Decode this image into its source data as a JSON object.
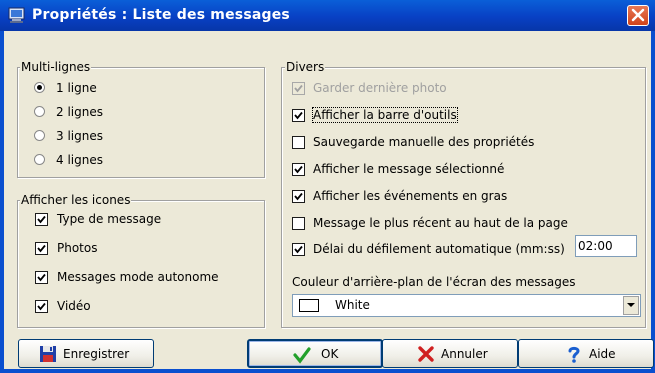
{
  "window": {
    "title": "Propriétés : Liste des messages",
    "close_icon": "close-icon",
    "app_icon": "computer-icon"
  },
  "multilines": {
    "legend": "Multi-lignes",
    "options": [
      {
        "label": "1 ligne",
        "selected": true
      },
      {
        "label": "2 lignes",
        "selected": false
      },
      {
        "label": "3 lignes",
        "selected": false
      },
      {
        "label": "4 lignes",
        "selected": false
      }
    ]
  },
  "icons_group": {
    "legend": "Afficher les icones",
    "items": [
      {
        "label": "Type de message",
        "checked": true
      },
      {
        "label": "Photos",
        "checked": true
      },
      {
        "label": "Messages mode autonome",
        "checked": true
      },
      {
        "label": "Vidéo",
        "checked": true
      }
    ]
  },
  "divers": {
    "legend": "Divers",
    "items": [
      {
        "label": "Garder dernière photo",
        "checked": true,
        "disabled": true
      },
      {
        "label": "Afficher la barre d'outils",
        "checked": true
      },
      {
        "label": "Sauvegarde manuelle des propriétés",
        "checked": false
      },
      {
        "label": "Afficher le message sélectionné",
        "checked": true
      },
      {
        "label": "Afficher les événements en gras",
        "checked": true
      },
      {
        "label": "Message le plus récent au haut de la page",
        "checked": false
      },
      {
        "label": "Délai du défilement automatique (mm:ss)",
        "checked": true
      }
    ],
    "delay_value": "02:00",
    "bg_color_label": "Couleur d'arrière-plan de l'écran des messages",
    "bg_color_value": "White"
  },
  "buttons": {
    "save": "Enregistrer",
    "ok": "OK",
    "cancel": "Annuler",
    "help": "Aide"
  },
  "colors": {
    "title_bar": "#0a4fcf",
    "close": "#d0431a",
    "dialog_bg": "#ece9d8"
  }
}
